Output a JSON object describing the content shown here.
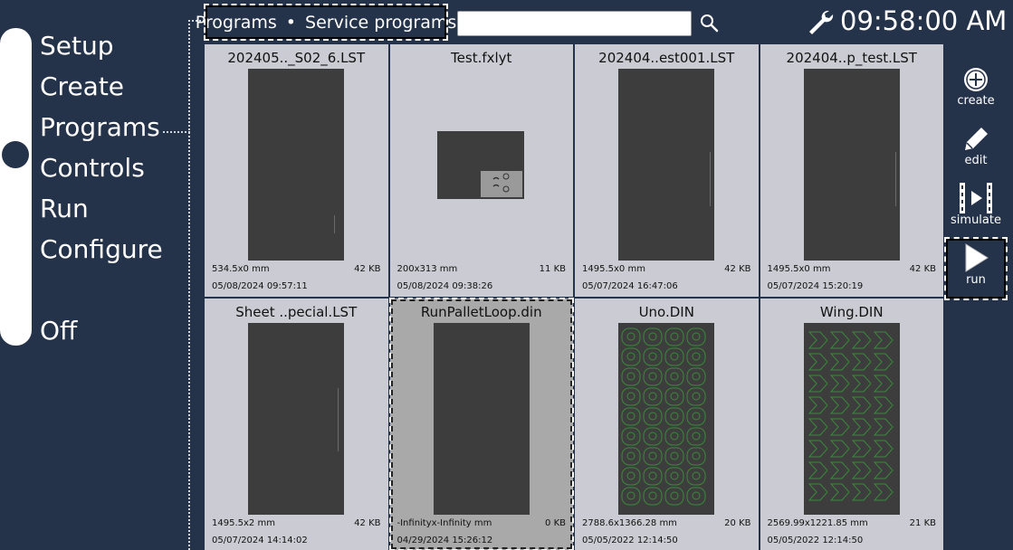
{
  "nav": {
    "items": [
      "Setup",
      "Create",
      "Programs",
      "Controls",
      "Run",
      "Configure",
      "Off"
    ],
    "selected": "Programs"
  },
  "header": {
    "breadcrumb": [
      "Programs",
      "Service programs"
    ],
    "search_value": "",
    "clock": "09:58:00 AM"
  },
  "programs": [
    {
      "name": "202405.._S02_6.LST",
      "size": "534.5x0 mm",
      "kb": "42 KB",
      "date": "05/08/2024 09:57:11",
      "preview": "tall"
    },
    {
      "name": "Test.fxlyt",
      "size": "200x313 mm",
      "kb": "11 KB",
      "date": "05/08/2024 09:38:26",
      "preview": "wide"
    },
    {
      "name": "202404..est001.LST",
      "size": "1495.5x0 mm",
      "kb": "42 KB",
      "date": "05/07/2024 16:47:06",
      "preview": "tall"
    },
    {
      "name": "202404..p_test.LST",
      "size": "1495.5x0 mm",
      "kb": "42 KB",
      "date": "05/07/2024 15:20:19",
      "preview": "tall"
    },
    {
      "name": "Sheet ..pecial.LST",
      "size": "1495.5x2 mm",
      "kb": "42 KB",
      "date": "05/07/2024 14:14:02",
      "preview": "tall"
    },
    {
      "name": "RunPalletLoop.din",
      "size": "-Infinityx-Infinity mm",
      "kb": "0 KB",
      "date": "04/29/2024 15:26:12",
      "preview": "tall",
      "selected": true
    },
    {
      "name": "Uno.DIN",
      "size": "2788.6x1366.28 mm",
      "kb": "20 KB",
      "date": "05/05/2022 12:14:50",
      "preview": "circles"
    },
    {
      "name": "Wing.DIN",
      "size": "2569.99x1221.85 mm",
      "kb": "21 KB",
      "date": "05/05/2022 12:14:50",
      "preview": "arrows"
    }
  ],
  "toolbar": {
    "create": "create",
    "edit": "edit",
    "simulate": "simulate",
    "run": "run",
    "active": "run"
  },
  "colors": {
    "background": "#25334a",
    "card": "#cbcbd3",
    "card_selected": "#a9a9a9",
    "preview": "#3d3d3d",
    "part_outline": "#3a8a3a"
  }
}
